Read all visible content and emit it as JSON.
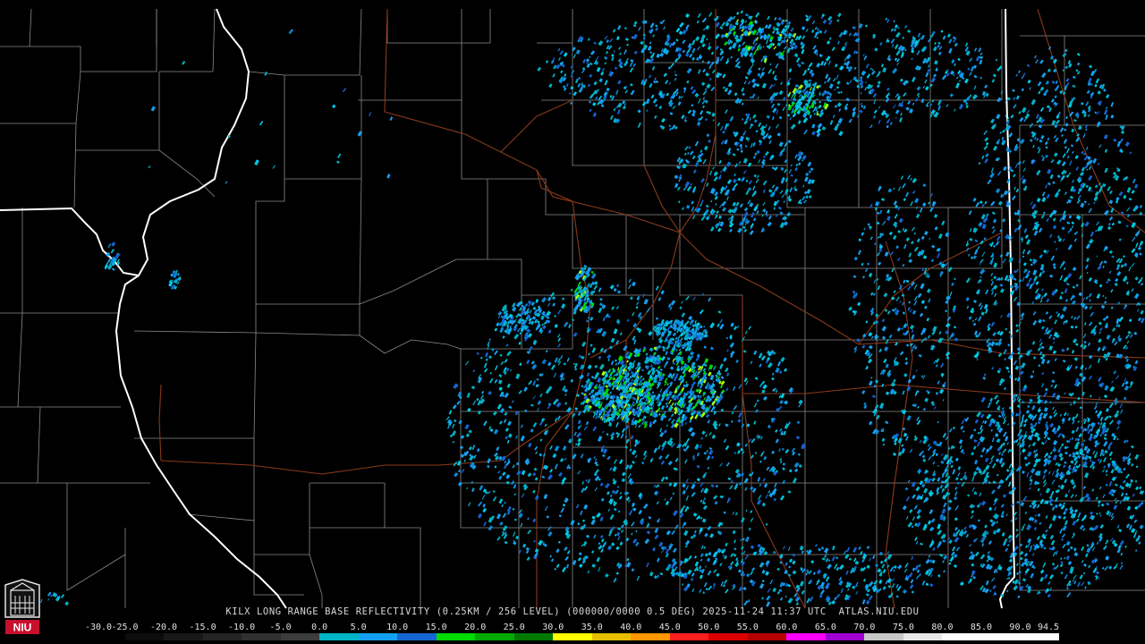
{
  "product": {
    "caption": "KILX LONG RANGE BASE REFLECTIVITY (0.25KM / 256 LEVEL) (000000/0000 0.5 DEG) 2025-11-24 11:37 UTC  ATLAS.NIU.EDU"
  },
  "legend": {
    "labels": [
      "-30.0",
      "-25.0",
      "-20.0",
      "-15.0",
      "-10.0",
      "-5.0",
      "0.0",
      "5.0",
      "10.0",
      "15.0",
      "20.0",
      "25.0",
      "30.0",
      "35.0",
      "40.0",
      "45.0",
      "50.0",
      "55.0",
      "60.0",
      "65.0",
      "70.0",
      "75.0",
      "80.0",
      "85.0",
      "90.0",
      "94.5"
    ],
    "colors": [
      "#000000",
      "#0c0c0c",
      "#181818",
      "#242424",
      "#303030",
      "#3c3c3c",
      "#00b4c8",
      "#14a0f0",
      "#1464d2",
      "#00dc00",
      "#00aa00",
      "#007800",
      "#ffff00",
      "#e6be00",
      "#ff9600",
      "#ff1e1e",
      "#dc0000",
      "#b40000",
      "#ff00ff",
      "#a000d2",
      "#c8c8c8",
      "#e8e8e8",
      "#ffffff",
      "#ffffff",
      "#ffffff"
    ]
  },
  "logo": {
    "text": "NIU"
  },
  "map": {
    "radar_site": "KILX",
    "colors": {
      "county_lines": "#8a8a8a",
      "roads": "#8b3a1a",
      "state_lines": "#ffffff",
      "background": "#000000"
    }
  }
}
